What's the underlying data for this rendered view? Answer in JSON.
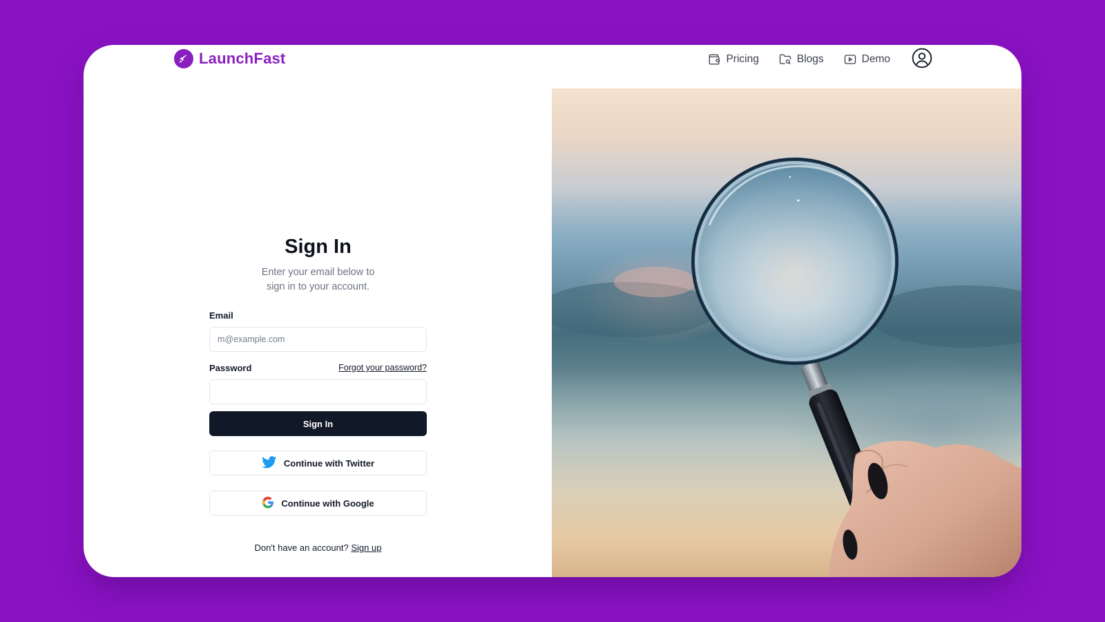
{
  "brand": {
    "name": "LaunchFast",
    "icon": "rocket-icon",
    "color": "#8a1fc0"
  },
  "nav": {
    "links": [
      {
        "label": "Pricing",
        "icon": "wallet-icon"
      },
      {
        "label": "Blogs",
        "icon": "folder-icon"
      },
      {
        "label": "Demo",
        "icon": "video-icon"
      }
    ],
    "profile_icon": "user-circle-icon"
  },
  "signin": {
    "title": "Sign In",
    "subtitle": "Enter your email below to sign in to your account.",
    "email_label": "Email",
    "email_placeholder": "m@example.com",
    "email_value": "",
    "password_label": "Password",
    "password_value": "",
    "forgot_label": "Forgot your password?",
    "submit_label": "Sign In",
    "twitter_label": "Continue with Twitter",
    "google_label": "Continue with Google",
    "no_account_text": "Don't have an account?",
    "signup_label": "Sign up"
  },
  "colors": {
    "background": "#8a12c4",
    "primary_button": "#111827",
    "twitter": "#1d9bf0"
  },
  "hero_image": {
    "subject": "magnifying-glass-photo"
  }
}
